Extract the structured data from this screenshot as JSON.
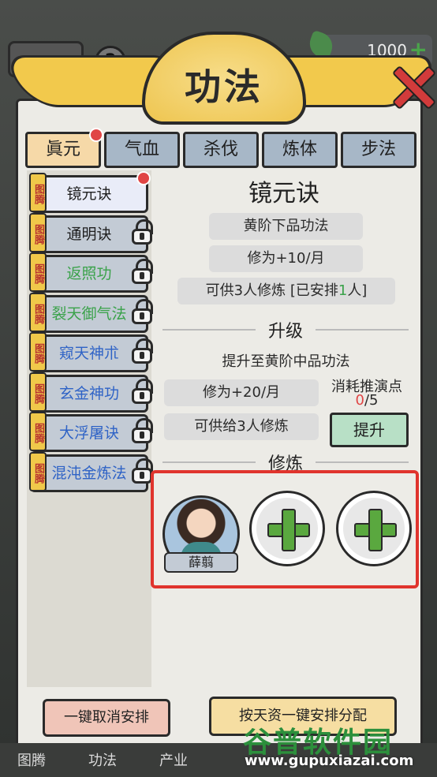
{
  "title": "功法",
  "currency": {
    "amount": "1000",
    "plus": "+"
  },
  "help_label": "?",
  "tabs": [
    {
      "label": "眞元",
      "active": true
    },
    {
      "label": "气血"
    },
    {
      "label": "杀伐"
    },
    {
      "label": "炼体"
    },
    {
      "label": "步法"
    }
  ],
  "tag_text": "图腾",
  "skills": [
    {
      "name": "镜元诀",
      "color": "#1f1f1f",
      "locked": false,
      "active": true
    },
    {
      "name": "通明诀",
      "color": "#1f1f1f",
      "locked": true
    },
    {
      "name": "返照功",
      "color": "#3aa24a",
      "locked": true
    },
    {
      "name": "裂天御气法",
      "color": "#3aa24a",
      "locked": true
    },
    {
      "name": "窥天神朮",
      "color": "#2f63c6",
      "locked": true
    },
    {
      "name": "玄金神功",
      "color": "#2f63c6",
      "locked": true
    },
    {
      "name": "大浮屠诀",
      "color": "#2f63c6",
      "locked": true
    },
    {
      "name": "混沌金炼法",
      "color": "#2f63c6",
      "locked": true
    }
  ],
  "detail": {
    "name": "镜元诀",
    "grade": "黄阶下品功法",
    "cultivation": "修为+10/月",
    "capacity_prefix": "可供3人修炼  [已安排",
    "capacity_count": "1",
    "capacity_suffix": "人]"
  },
  "upgrade": {
    "heading": "升级",
    "desc": "提升至黄阶中品功法",
    "cultivation": "修为+20/月",
    "capacity": "可供给3人修炼",
    "cost_label": "消耗推演点",
    "cost_current": "0",
    "cost_total": "/5",
    "button": "提升"
  },
  "practice": {
    "heading": "修炼",
    "member_name": "薛翦"
  },
  "bottom": {
    "cancel": "一键取消安排",
    "assign": "按天资一键安排分配"
  },
  "nav": [
    "图腾",
    "功法",
    "产业"
  ],
  "watermark": {
    "cn": "谷普软件园",
    "url": "www.gupuxiazai.com"
  }
}
